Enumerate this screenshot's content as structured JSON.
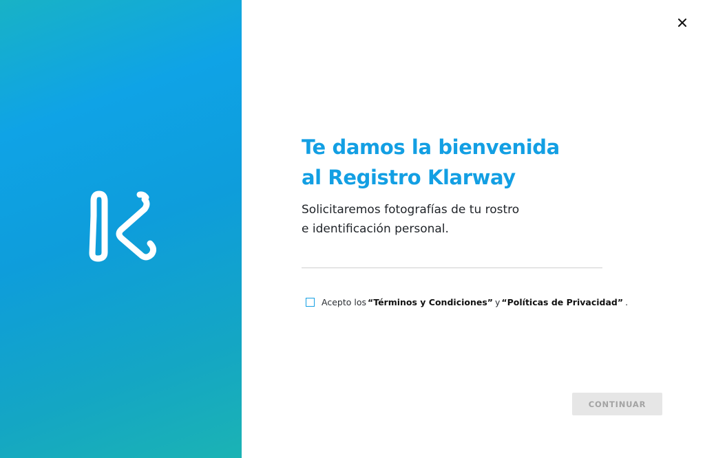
{
  "brand": {
    "logo_icon": "klarway-k-logo",
    "gradient_colors": [
      "#18b2c6",
      "#0fa3e6",
      "#0e9ddb",
      "#1bb3b4"
    ]
  },
  "header": {
    "close_icon": "close-icon"
  },
  "main": {
    "headline_line1": "Te damos la bienvenida",
    "headline_line2": "al Registro Klarway",
    "subtitle_line1": "Solicitaremos fotografías de tu rostro",
    "subtitle_line2": "e identificación personal."
  },
  "terms": {
    "checked": false,
    "prefix": "Acepto los",
    "terms_link": "“Términos y Condiciones”",
    "conjunction": "y",
    "privacy_link": "“Políticas de Privacidad”",
    "suffix": "."
  },
  "actions": {
    "continue_label": "CONTINUAR",
    "continue_enabled": false
  },
  "colors": {
    "accent": "#139fe3",
    "button_disabled_bg": "#e6e6e6",
    "button_disabled_text": "#a3a3a3"
  }
}
